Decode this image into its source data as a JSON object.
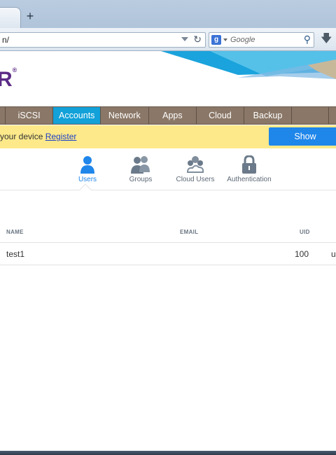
{
  "browser": {
    "url": "n/",
    "search_engine_label": "g",
    "search_placeholder": "Google"
  },
  "logo": {
    "text": "R",
    "reg": "®"
  },
  "menu": [
    {
      "label": "",
      "active": false
    },
    {
      "label": "iSCSI",
      "active": false
    },
    {
      "label": "Accounts",
      "active": true
    },
    {
      "label": "Network",
      "active": false
    },
    {
      "label": "Apps",
      "active": false
    },
    {
      "label": "Cloud",
      "active": false
    },
    {
      "label": "Backup",
      "active": false
    },
    {
      "label": "",
      "active": false
    },
    {
      "label": "",
      "active": false
    }
  ],
  "notice": {
    "text": "your device ",
    "link": "Register",
    "button": "Show"
  },
  "subnav": {
    "users": "Users",
    "groups": "Groups",
    "cloud_users": "Cloud Users",
    "authentication": "Authentication"
  },
  "table": {
    "columns": {
      "name": "NAME",
      "email": "EMAIL",
      "uid": "UID"
    },
    "rows": [
      {
        "name": "test1",
        "email": "",
        "uid": "100",
        "extra": "u"
      }
    ]
  },
  "colors": {
    "accent": "#12a1d8",
    "menu_bg": "#8a7767",
    "notice_bg": "#fde98a",
    "button": "#1f86ea",
    "brand": "#5b2a86"
  }
}
